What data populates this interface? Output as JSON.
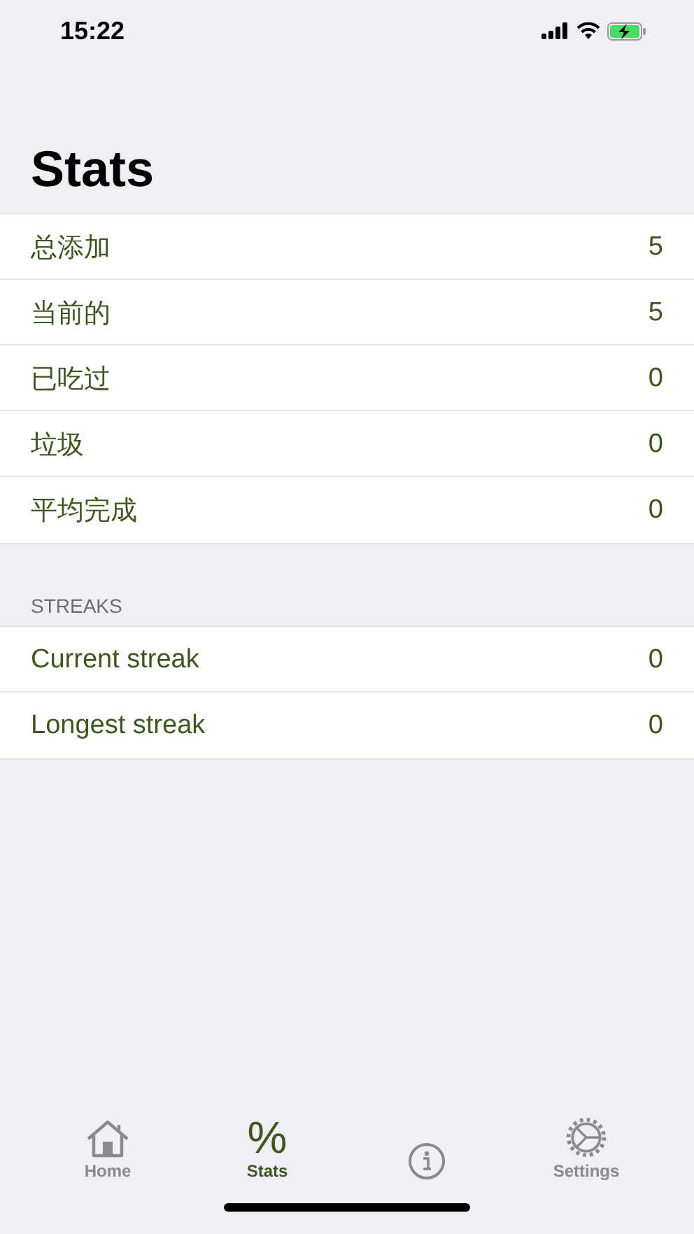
{
  "status_bar": {
    "time": "15:22"
  },
  "title": "Stats",
  "stats": [
    {
      "label": "总添加",
      "value": "5"
    },
    {
      "label": "当前的",
      "value": "5"
    },
    {
      "label": "已吃过",
      "value": "0"
    },
    {
      "label": "垃圾",
      "value": "0"
    },
    {
      "label": "平均完成",
      "value": "0"
    }
  ],
  "streaks": {
    "header": "STREAKS",
    "rows": [
      {
        "label": "Current streak",
        "value": "0"
      },
      {
        "label": "Longest streak",
        "value": "0"
      }
    ]
  },
  "tab_bar": [
    {
      "label": "Home",
      "selected": false
    },
    {
      "label": "Stats",
      "symbol": "%",
      "selected": true
    },
    {
      "selected": false
    },
    {
      "label": "Settings",
      "selected": false
    }
  ]
}
